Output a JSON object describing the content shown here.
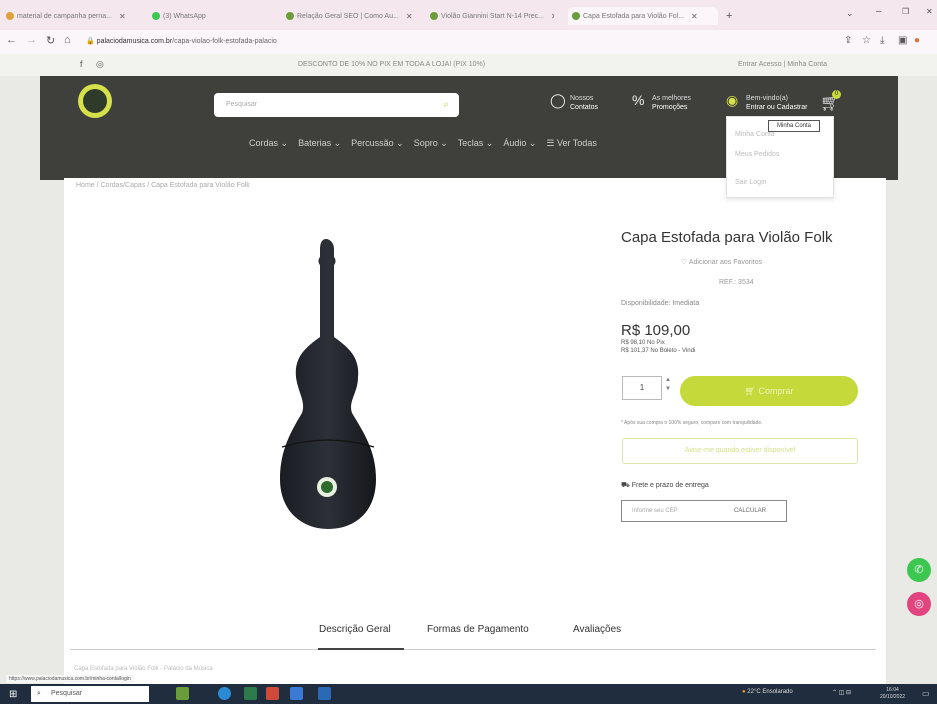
{
  "browser": {
    "tabs": [
      {
        "label": "material de campanha perna..."
      },
      {
        "label": "(3) WhatsApp"
      },
      {
        "label": "Relação Geral SEO | Como Au..."
      },
      {
        "label": "Violão Giannini Start N-14 Prec..."
      },
      {
        "label": "Capa Estofada para Violão Fol..."
      }
    ],
    "new_tab": "+",
    "url_domain": "palaciodamusica.com.br",
    "url_path": "/capa-violao-folk-estofada-palacio",
    "url_lock": "🔒"
  },
  "topstrip": {
    "social": [
      "f",
      "◎"
    ],
    "promo": "DESCONTO DE 10% NO PIX EM TODA A LOJA! (PIX 10%)",
    "right": "Entrar  Acesso  |  Minha Conta"
  },
  "header": {
    "search_placeholder": "Pesquisar",
    "contacts_line1": "Nossos",
    "contacts_line2": "Contatos",
    "promo_line1": "As melhores",
    "promo_line2": "Promoções",
    "account_line1": "Bem-vindo(a)",
    "account_line2": "Entrar ou Cadastrar",
    "cart_count": "0",
    "menu": [
      "Cordas ⌄",
      "Baterias ⌄",
      "Percussão ⌄",
      "Sopro ⌄",
      "Teclas ⌄",
      "Áudio ⌄",
      "☰ Ver Todas"
    ],
    "dropdown": [
      "Minha Conta",
      "Meus Pedidos",
      "Sair Login"
    ],
    "tooltip": "Minha Conta"
  },
  "breadcrumb": "Home  /  Cordas/Capas  /  Capa Estofada para Violão Folk",
  "product": {
    "title": "Capa Estofada para Violão Folk",
    "favorite": "♡ Adicionar aos Favoritos",
    "ref": "REF.: 3534",
    "availability": "Disponibilidade: Imediata",
    "price": "R$ 109,00",
    "pix": "R$ 98,10 No Pix",
    "boleto": "R$ 101,37 No Boleto - Vindi",
    "quantity": "1",
    "buy_label": "Comprar",
    "note": "* Após sua compra o 100% seguro, compare com tranquilidade.",
    "notify_label": "Avise-me quando estiver disponível",
    "shipping_label": "Frete e prazo de entrega",
    "cep_placeholder": "Informe seu CEP",
    "cep_button": "CALCULAR"
  },
  "tabs": [
    "Descrição Geral",
    "Formas de Pagamento",
    "Avaliações"
  ],
  "footer_text": "Capa Estofada para Violão Folk - Palácio da Música",
  "status_url": "https://www.palaciodamusica.com.br/minha-conta/login",
  "taskbar": {
    "search_label": "Pesquisar",
    "weather": "22°C  Ensolarado",
    "time": "16:04",
    "date": "20/10/2022"
  },
  "colors": {
    "accent": "#c5d93a",
    "header_bg": "#3f3f3c",
    "whatsapp": "#3cc850",
    "instagram": "#e24480"
  }
}
